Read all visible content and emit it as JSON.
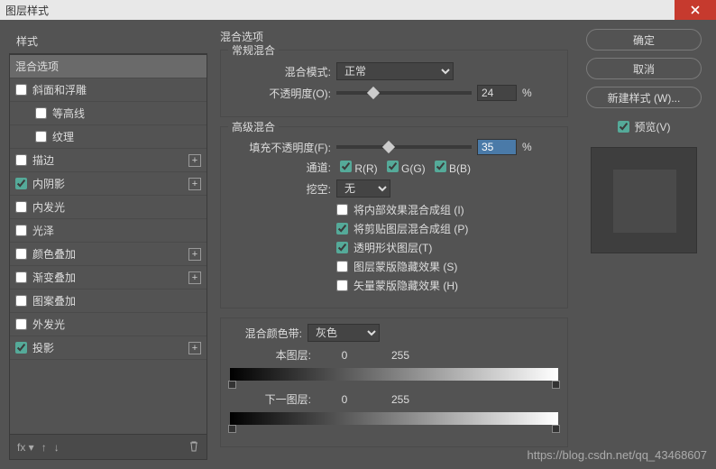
{
  "title": "图层样式",
  "sidebar": {
    "header": "样式",
    "items": [
      {
        "label": "混合选项",
        "checked": null,
        "selected": true,
        "plus": false,
        "indent": false
      },
      {
        "label": "斜面和浮雕",
        "checked": false,
        "plus": false,
        "indent": false
      },
      {
        "label": "等高线",
        "checked": false,
        "plus": false,
        "indent": true
      },
      {
        "label": "纹理",
        "checked": false,
        "plus": false,
        "indent": true
      },
      {
        "label": "描边",
        "checked": false,
        "plus": true,
        "indent": false
      },
      {
        "label": "内阴影",
        "checked": true,
        "plus": true,
        "indent": false
      },
      {
        "label": "内发光",
        "checked": false,
        "plus": false,
        "indent": false
      },
      {
        "label": "光泽",
        "checked": false,
        "plus": false,
        "indent": false
      },
      {
        "label": "颜色叠加",
        "checked": false,
        "plus": true,
        "indent": false
      },
      {
        "label": "渐变叠加",
        "checked": false,
        "plus": true,
        "indent": false
      },
      {
        "label": "图案叠加",
        "checked": false,
        "plus": false,
        "indent": false
      },
      {
        "label": "外发光",
        "checked": false,
        "plus": false,
        "indent": false
      },
      {
        "label": "投影",
        "checked": true,
        "plus": true,
        "indent": false
      }
    ],
    "footer": {
      "fx": "fx"
    }
  },
  "center": {
    "panel_title": "混合选项",
    "general": {
      "title": "常规混合",
      "blend_mode_label": "混合模式:",
      "blend_mode_value": "正常",
      "opacity_label": "不透明度(O):",
      "opacity_value": "24",
      "opacity_unit": "%"
    },
    "advanced": {
      "title": "高级混合",
      "fill_label": "填充不透明度(F):",
      "fill_value": "35",
      "fill_unit": "%",
      "channels_label": "通道:",
      "channels": {
        "r": "R(R)",
        "g": "G(G)",
        "b": "B(B)"
      },
      "knockout_label": "挖空:",
      "knockout_value": "无",
      "options": [
        {
          "label": "将内部效果混合成组 (I)",
          "checked": false
        },
        {
          "label": "将剪贴图层混合成组 (P)",
          "checked": true
        },
        {
          "label": "透明形状图层(T)",
          "checked": true
        },
        {
          "label": "图层蒙版隐藏效果 (S)",
          "checked": false
        },
        {
          "label": "矢量蒙版隐藏效果 (H)",
          "checked": false
        }
      ]
    },
    "blend_if": {
      "label": "混合颜色带:",
      "value": "灰色",
      "this_layer": {
        "label": "本图层:",
        "low": "0",
        "high": "255"
      },
      "under_layer": {
        "label": "下一图层:",
        "low": "0",
        "high": "255"
      }
    }
  },
  "right": {
    "ok": "确定",
    "cancel": "取消",
    "new_style": "新建样式 (W)...",
    "preview": "预览(V)"
  },
  "watermark": "https://blog.csdn.net/qq_43468607"
}
